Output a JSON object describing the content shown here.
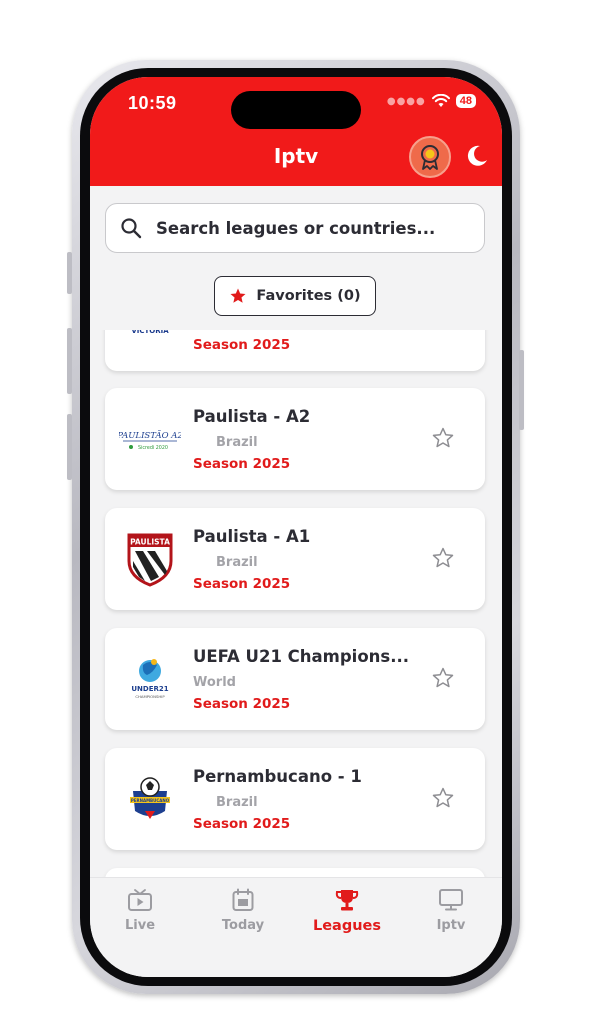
{
  "status": {
    "time": "10:59",
    "battery": "48"
  },
  "header": {
    "title": "Iptv"
  },
  "search": {
    "placeholder": "Search leagues or countries..."
  },
  "favorites": {
    "label": "Favorites (0)"
  },
  "leagues": [
    {
      "name": "",
      "country": "",
      "season": "Season 2025",
      "logo_text": "FOOTBALL VICTORIA",
      "logo_icon": "football-victoria-logo"
    },
    {
      "name": "Paulista - A2",
      "country": "Brazil",
      "season": "Season 2025",
      "logo_text": "PAULISTÃO A2",
      "logo_subtext": "Sicredi 2020",
      "logo_icon": "paulista-a2-logo"
    },
    {
      "name": "Paulista - A1",
      "country": "Brazil",
      "season": "Season 2025",
      "logo_text": "PAULISTA",
      "logo_icon": "paulista-a1-shield-logo"
    },
    {
      "name": "UEFA U21 Champions...",
      "country": "World",
      "season": "Season 2025",
      "logo_text": "UNDER21",
      "logo_subtext": "CHAMPIONSHIP",
      "logo_icon": "uefa-u21-logo"
    },
    {
      "name": "Pernambucano - 1",
      "country": "Brazil",
      "season": "Season 2025",
      "logo_text": "PERNAMBUCANO",
      "logo_icon": "pernambucano-logo"
    }
  ],
  "tabs": [
    {
      "label": "Live",
      "icon": "tv-play-icon",
      "active": false
    },
    {
      "label": "Today",
      "icon": "calendar-icon",
      "active": false
    },
    {
      "label": "Leagues",
      "icon": "trophy-icon",
      "active": true
    },
    {
      "label": "Iptv",
      "icon": "monitor-icon",
      "active": false
    }
  ],
  "colors": {
    "brand_red": "#f11a1a",
    "season_red": "#e11b1b",
    "text_dark": "#2c2c34",
    "muted": "#a3a3a8",
    "background": "#f3f3f4"
  }
}
